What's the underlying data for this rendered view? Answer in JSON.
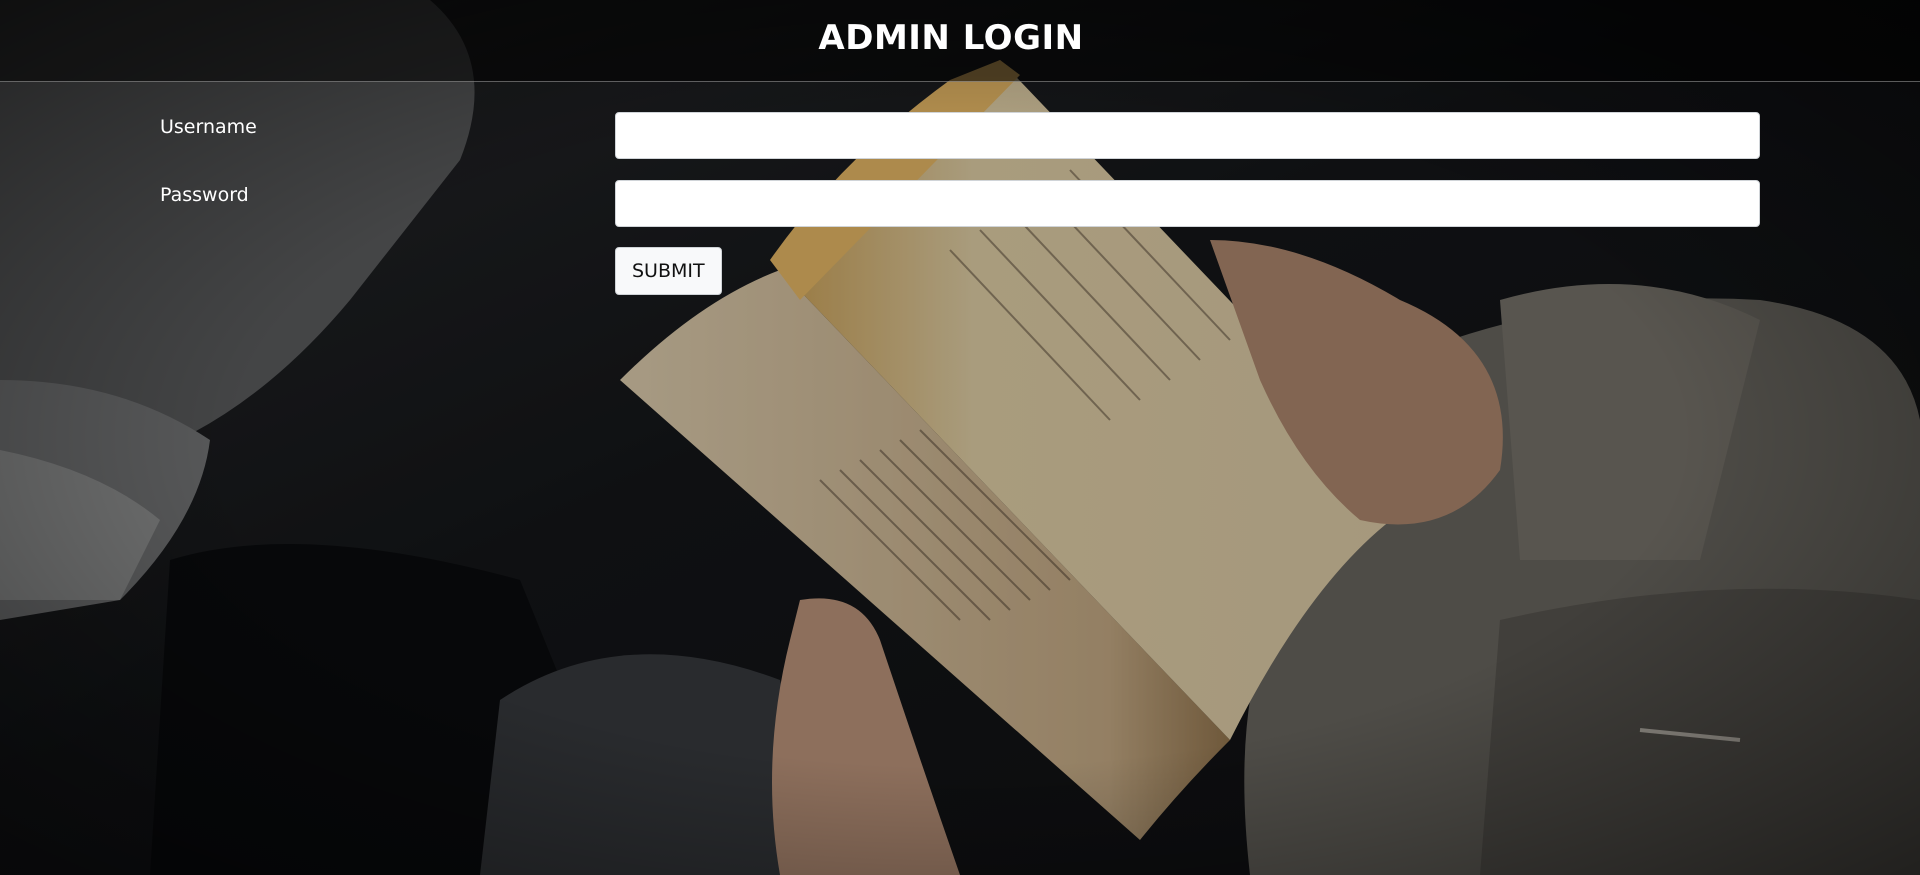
{
  "header": {
    "title": "ADMIN LOGIN"
  },
  "form": {
    "username_label": "Username",
    "password_label": "Password",
    "username_value": "",
    "password_value": "",
    "submit_label": "SUBMIT"
  },
  "background": {
    "subject": "photo of hands holding an open book",
    "overlay_color": "#000000"
  }
}
